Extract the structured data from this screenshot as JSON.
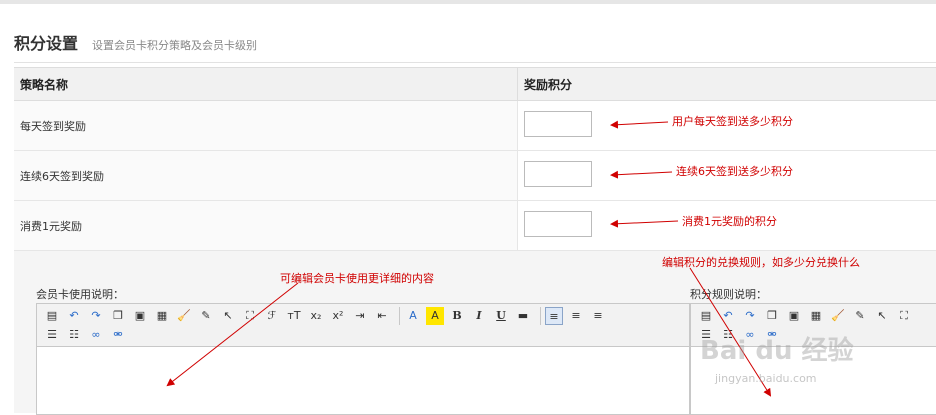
{
  "header": {
    "title": "积分设置",
    "subtitle": "设置会员卡积分策略及会员卡级别"
  },
  "table": {
    "col_name": "策略名称",
    "col_points": "奖励积分",
    "rows": [
      {
        "label": "每天签到奖励",
        "value": ""
      },
      {
        "label": "连续6天签到奖励",
        "value": ""
      },
      {
        "label": "消费1元奖励",
        "value": ""
      }
    ]
  },
  "annotations": {
    "daily": "用户每天签到送多少积分",
    "streak": "连续6天签到送多少积分",
    "spend": "消费1元奖励的积分",
    "editor_left": "可编辑会员卡使用更详细的内容",
    "editor_right": "编辑积分的兑换规则，如多少分兑换什么"
  },
  "editors": {
    "left_label": "会员卡使用说明：",
    "right_label": "积分规则说明："
  },
  "toolbar": {
    "font_family": "ℱ",
    "font_size": "тT",
    "bold": "B",
    "italic": "I",
    "underline": "U",
    "font_color": "A",
    "highlight": "A",
    "subscript": "x₂",
    "superscript": "x²"
  },
  "watermark": {
    "brand": "Bai du 经验",
    "url": "jingyan.baidu.com"
  },
  "colors": {
    "annotation": "#d00000",
    "header_bg": "#f1f1f1"
  }
}
